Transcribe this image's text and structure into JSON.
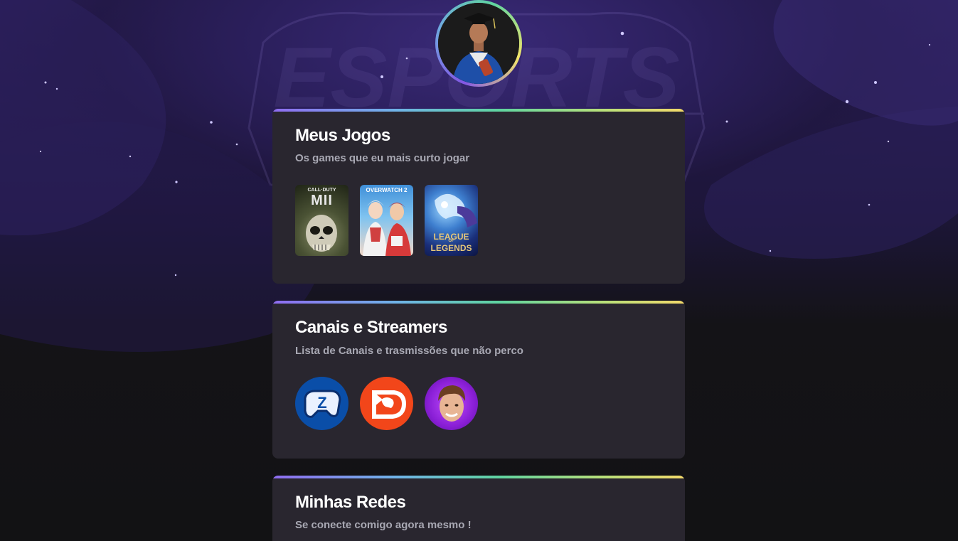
{
  "profile": {
    "avatar_icon": "profile-photo-graduate"
  },
  "background": {
    "watermark_text": "ESPORTS"
  },
  "sections": [
    {
      "title": "Meus Jogos",
      "subtitle": "Os games que eu mais curto jogar",
      "items": [
        {
          "name": "Call of Duty MWII",
          "logo_text": "CALL·DUTY",
          "logo_big": "MII"
        },
        {
          "name": "Overwatch 2",
          "logo_text": "OVERWATCH 2"
        },
        {
          "name": "League of Legends",
          "logo_text": "LEAGUE",
          "logo_of": "OF",
          "logo_big": "LEGENDS"
        }
      ]
    },
    {
      "title": "Canais e Streamers",
      "subtitle": "Lista de Canais e trasmissões que não perco",
      "items": [
        {
          "name": "Zangado",
          "logo_letter": "Z"
        },
        {
          "name": "Dragon channel",
          "logo_icon": "dragon-icon"
        },
        {
          "name": "Streamer",
          "logo_icon": "streamer-face"
        }
      ]
    },
    {
      "title": "Minhas Redes",
      "subtitle": "Se conecte comigo agora mesmo !"
    }
  ],
  "colors": {
    "card_bg": "#29262f",
    "title": "#ffffff",
    "subtitle": "#a8a8b3",
    "gradient": [
      "#8f6cf0",
      "#6fb3e8",
      "#5fd4a0",
      "#f3d96a"
    ]
  }
}
